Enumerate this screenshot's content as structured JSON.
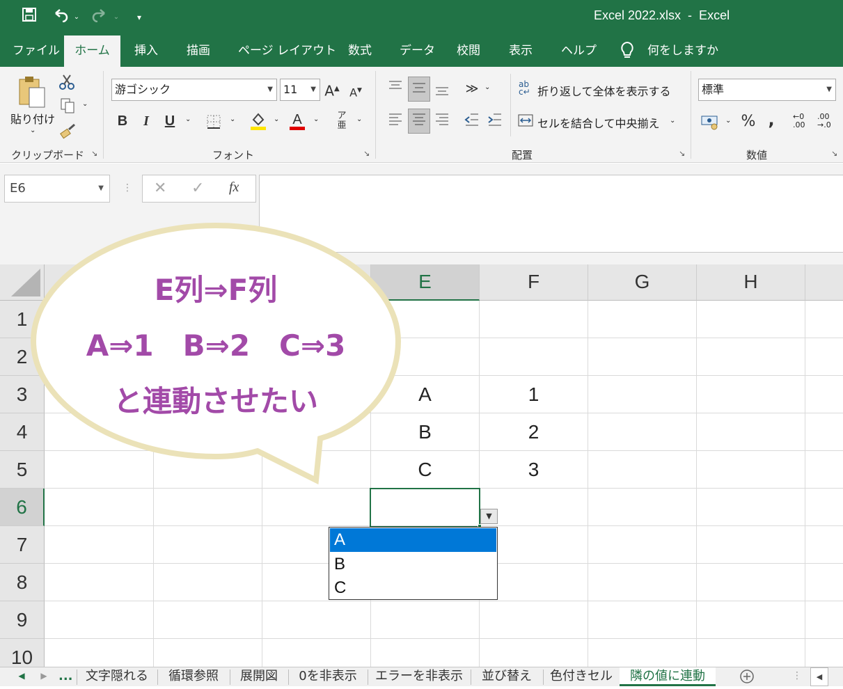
{
  "titlebar": {
    "title": "Excel 2022.xlsx  -  Excel",
    "bg": "#217346"
  },
  "tabs": [
    {
      "label": "ファイル"
    },
    {
      "label": "ホーム"
    },
    {
      "label": "挿入"
    },
    {
      "label": "描画"
    },
    {
      "label": "ページ レイアウト"
    },
    {
      "label": "数式"
    },
    {
      "label": "データ"
    },
    {
      "label": "校閲"
    },
    {
      "label": "表示"
    },
    {
      "label": "ヘルプ"
    }
  ],
  "tellme": {
    "label": "何をしますか"
  },
  "ribbon": {
    "clipboard": {
      "paste_label": "貼り付け",
      "group_label": "クリップボード"
    },
    "font": {
      "name": "游ゴシック",
      "size": "11",
      "bold": "B",
      "italic": "I",
      "underline": "U",
      "group_label": "フォント"
    },
    "alignment": {
      "wrap_label": "折り返して全体を表示する",
      "merge_label": "セルを結合して中央揃え",
      "group_label": "配置"
    },
    "number": {
      "format": "標準",
      "percent": "%",
      "comma": ",",
      "inc_dec_1": "←0",
      "inc_dec_1b": ".00",
      "inc_dec_2": ".00",
      "inc_dec_2b": "→.0",
      "group_label": "数値"
    }
  },
  "formula": {
    "name_box": "E6",
    "fx": "fx",
    "value": ""
  },
  "grid": {
    "columns": [
      "E",
      "F",
      "G",
      "H"
    ],
    "rows": [
      "1",
      "2",
      "3",
      "4",
      "5",
      "6",
      "7",
      "8",
      "9",
      "10"
    ],
    "cells": {
      "E3": "A",
      "F3": "1",
      "E4": "B",
      "F4": "2",
      "E5": "C",
      "F5": "3"
    },
    "active_cell": "E6"
  },
  "dropdown": {
    "options": [
      "A",
      "B",
      "C"
    ],
    "highlighted": "A"
  },
  "callout": {
    "line1": "E列⇒F列",
    "line2": "A⇒1　B⇒2　C⇒3",
    "line3": "と連動させたい",
    "text_color": "#a24aa8",
    "border_color": "#e8e0b4"
  },
  "sheets": {
    "ellipsis": "...",
    "tabs": [
      "文字隠れる",
      "循環参照",
      "展開図",
      "0を非表示",
      "エラーを非表示",
      "並び替え",
      "色付きセル",
      "隣の値に連動"
    ],
    "active": "隣の値に連動"
  }
}
